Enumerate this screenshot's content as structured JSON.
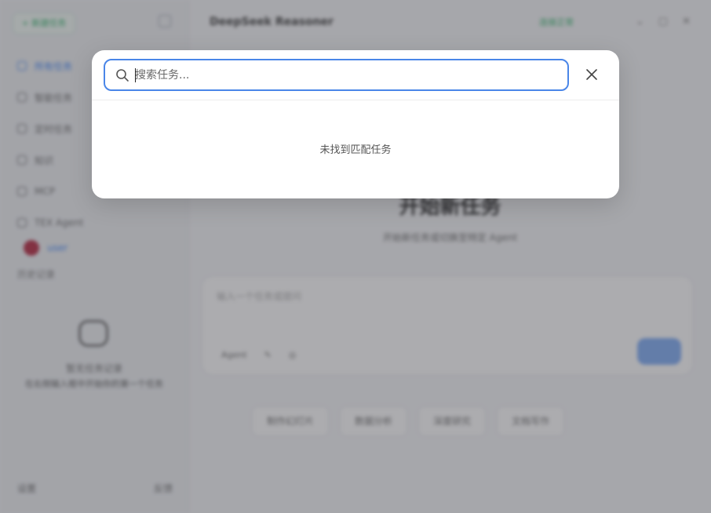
{
  "sidebar": {
    "new_task_label": "+ 新建任务",
    "nav_items": [
      {
        "label": "所有任务"
      },
      {
        "label": "智能任务"
      },
      {
        "label": "定时任务"
      },
      {
        "label": "知识"
      },
      {
        "label": "MCP"
      },
      {
        "label": "TEX Agent"
      }
    ],
    "user_name": "user",
    "history_label": "历史记录",
    "empty_title": "暂无任务记录",
    "empty_desc": "在右侧输入框中开始你的第一个任务",
    "footer_left": "设置",
    "footer_right": "反馈"
  },
  "main": {
    "model_name": "DeepSeek Reasoner",
    "status_label": "连接正常",
    "hero_title": "开始新任务",
    "hero_subtitle": "开始新任务或切换至特定 Agent",
    "composer_placeholder": "输入一个任务或提问",
    "composer_tool": "Agent",
    "quick_actions": [
      {
        "label": "制作幻灯片"
      },
      {
        "label": "数据分析"
      },
      {
        "label": "深度研究"
      },
      {
        "label": "文档写作"
      }
    ]
  },
  "search_modal": {
    "placeholder": "搜索任务...",
    "query": "",
    "empty_message": "未找到匹配任务"
  },
  "colors": {
    "accent": "#4a86e8",
    "success": "#2fb36a",
    "overlay": "rgba(70,72,78,0.45)"
  }
}
